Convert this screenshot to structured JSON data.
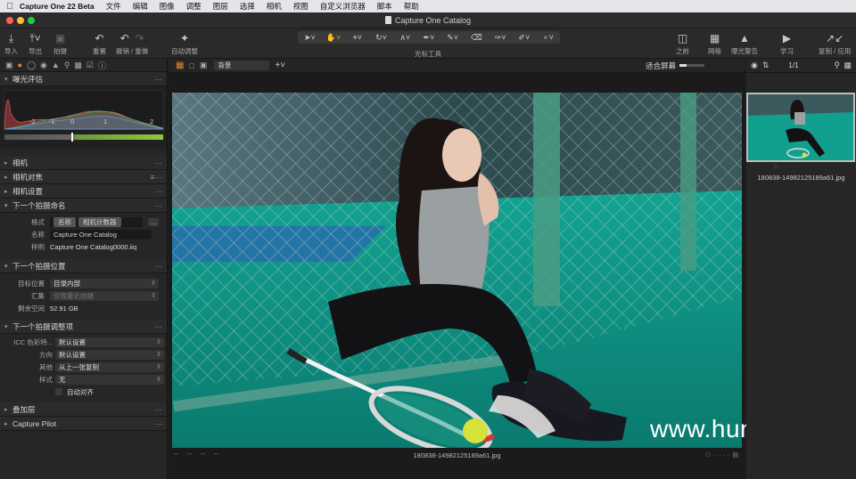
{
  "menubar": {
    "app_name": "Capture One 22 Beta",
    "items": [
      "文件",
      "编辑",
      "图像",
      "调整",
      "图层",
      "选择",
      "相机",
      "视图",
      "自定义浏览器",
      "脚本",
      "帮助"
    ]
  },
  "window": {
    "title": "Capture One Catalog"
  },
  "toolbar": {
    "import": "导入",
    "export": "导出",
    "capture": "拍摄",
    "reset": "重置",
    "undo_redo": "撤销 / 重做",
    "auto_adjust": "自动调整",
    "cursor_tools": "光标工具",
    "before": "之前",
    "grid": "网格",
    "exposure_warning": "曝光警告",
    "learn": "学习",
    "copy_apply": "复制 / 应用"
  },
  "left_panel": {
    "exposure_section": "曝光评估",
    "meter_ticks": [
      "-2",
      "-1",
      "0",
      "1",
      "2"
    ],
    "camera": "相机",
    "camera_focus": "相机对焦",
    "camera_settings": "相机设置",
    "next_capture_naming": "下一个拍摄命名",
    "format_label": "格式",
    "format_tokens": [
      "名称",
      "相机计数器"
    ],
    "format_more": "...",
    "name_label": "名称",
    "name_value": "Capture One Catalog",
    "sample_label": "样例",
    "sample_value": "Capture One Catalog0000.iiq",
    "next_capture_location": "下一个拍摄位置",
    "destination_label": "目标位置",
    "destination_value": "目录内部",
    "collection_label": "汇集",
    "collection_value": "仅限最近拍摄",
    "remaining_label": "剩余空间",
    "remaining_value": "52.91 GB",
    "next_capture_adjustments": "下一个拍摄调整项",
    "icc_label": "ICC 色彩特...",
    "icc_value": "默认设置",
    "orientation_label": "方向",
    "orientation_value": "默认设置",
    "other_label": "其他",
    "other_value": "从上一张复制",
    "style_label": "样式",
    "style_value": "无",
    "auto_align": "自动对齐",
    "overlay": "叠加层",
    "capture_pilot": "Capture Pilot"
  },
  "viewer": {
    "background_select": "背景",
    "fit_label": "适合屏幕",
    "filename": "180838-14982125189a61.jpg",
    "meta": [
      "--",
      "--",
      "--",
      "--"
    ]
  },
  "browser": {
    "counter": "1/1",
    "thumb_name": "180838-14982125189a61.jpg"
  },
  "watermark": "www.hunls.com",
  "colors": {
    "accent": "#e08a2c",
    "court": "#0e8f82"
  }
}
